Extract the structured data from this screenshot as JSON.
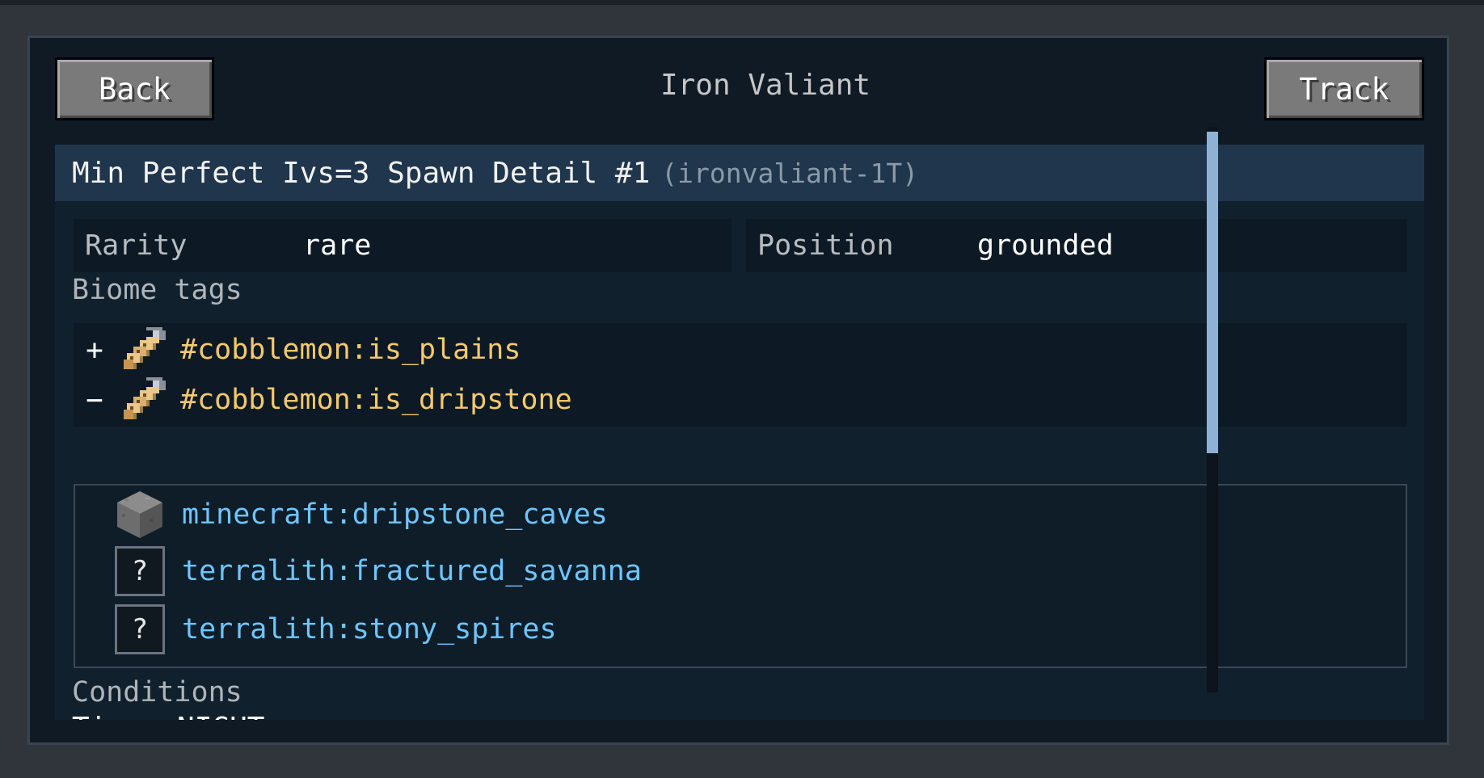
{
  "window": {
    "title": "Iron Valiant",
    "back_label": "Back",
    "track_label": "Track"
  },
  "detail": {
    "header": "Min Perfect Ivs=3 Spawn Detail #1",
    "header_id": "(ironvaliant-1T)",
    "rarity_label": "Rarity",
    "rarity_value": "rare",
    "position_label": "Position",
    "position_value": "grounded",
    "biome_tags_label": "Biome tags",
    "biome_tags": [
      {
        "toggle": "+",
        "icon": "name-tag-icon",
        "tag": "#cobblemon:is_plains",
        "expanded": false
      },
      {
        "toggle": "−",
        "icon": "name-tag-icon",
        "tag": "#cobblemon:is_dripstone",
        "expanded": true
      }
    ],
    "biomes": [
      {
        "icon": "stone-block-icon",
        "name": "minecraft:dripstone_caves"
      },
      {
        "icon": "unknown-question-icon",
        "glyph": "?",
        "name": "terralith:fractured_savanna"
      },
      {
        "icon": "unknown-question-icon",
        "glyph": "?",
        "name": "terralith:stony_spires"
      }
    ],
    "conditions_label": "Conditions",
    "time_condition": "Time: NIGHT"
  },
  "colors": {
    "tag_text": "#f5c96b",
    "biome_text": "#6ec6ff",
    "header_bg": "#20364d",
    "scroll_thumb": "#8fb2d4"
  }
}
